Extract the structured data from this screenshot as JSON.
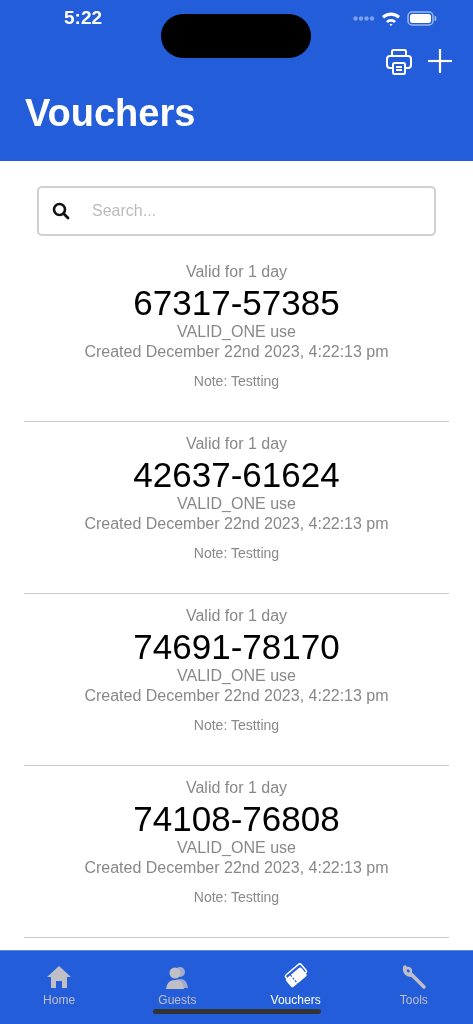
{
  "status_bar": {
    "time": "5:22"
  },
  "header": {
    "title": "Vouchers"
  },
  "search": {
    "placeholder": "Search..."
  },
  "vouchers": [
    {
      "validity": "Valid for 1 day",
      "code": "67317-57385",
      "usage": "VALID_ONE use",
      "created": "Created December 22nd 2023, 4:22:13 pm",
      "note": "Note: Testting"
    },
    {
      "validity": "Valid for 1 day",
      "code": "42637-61624",
      "usage": "VALID_ONE use",
      "created": "Created December 22nd 2023, 4:22:13 pm",
      "note": "Note: Testting"
    },
    {
      "validity": "Valid for 1 day",
      "code": "74691-78170",
      "usage": "VALID_ONE use",
      "created": "Created December 22nd 2023, 4:22:13 pm",
      "note": "Note: Testting"
    },
    {
      "validity": "Valid for 1 day",
      "code": "74108-76808",
      "usage": "VALID_ONE use",
      "created": "Created December 22nd 2023, 4:22:13 pm",
      "note": "Note: Testting"
    }
  ],
  "tab_bar": [
    {
      "label": "Home",
      "kind": "home",
      "selected": false
    },
    {
      "label": "Guests",
      "kind": "guests",
      "selected": false
    },
    {
      "label": "Vouchers",
      "kind": "vouchers",
      "selected": true
    },
    {
      "label": "Tools",
      "kind": "tools",
      "selected": false
    }
  ]
}
